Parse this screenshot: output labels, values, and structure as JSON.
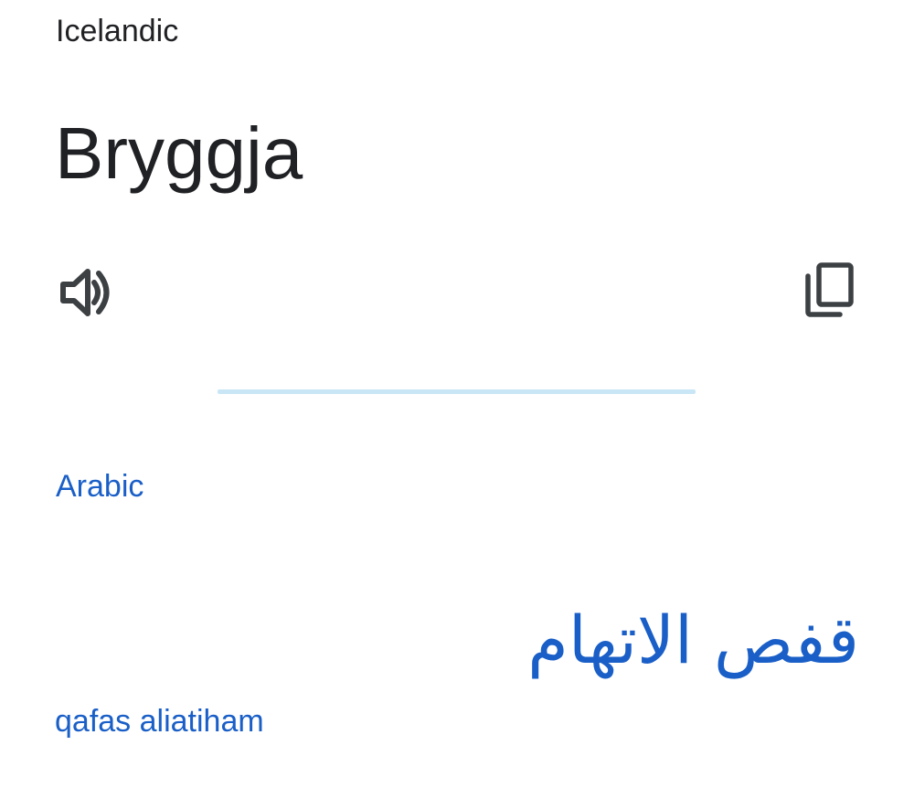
{
  "source": {
    "language": "Icelandic",
    "text": "Bryggja"
  },
  "actions": {
    "listen_icon": "speaker-icon",
    "copy_icon": "copy-icon"
  },
  "target": {
    "language": "Arabic",
    "text": "قفص الاتهام",
    "transliteration": "qafas aliatiham"
  },
  "colors": {
    "text_primary": "#202124",
    "accent_blue": "#1a5fc7",
    "icon_gray": "#3c4043",
    "divider": "#c9e6f6"
  }
}
